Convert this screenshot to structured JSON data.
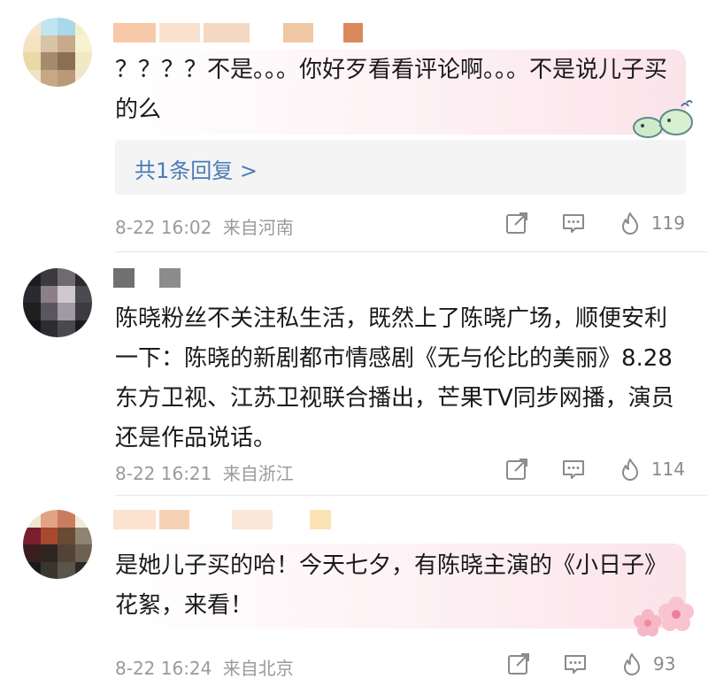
{
  "comments": [
    {
      "text": "？？？？不是。。。你好歹看看评论啊。。。不是说儿子买的么",
      "reply_link": "共1条回复 >",
      "timestamp": "8-22 16:02",
      "location": "来自河南",
      "likes": "119",
      "sticker_icon": "whale-sticker-icon"
    },
    {
      "text": "陈晓粉丝不关注私生活，既然上了陈晓广场，顺便安利一下：陈晓的新剧都市情感剧《无与伦比的美丽》8.28东方卫视、江苏卫视联合播出，芒果TV同步网播，演员还是作品说话。",
      "timestamp": "8-22 16:21",
      "location": "来自浙江",
      "likes": "114"
    },
    {
      "text": "是她儿子买的哈！今天七夕，有陈晓主演的《小日子》花絮，来看！",
      "timestamp": "8-22 16:24",
      "location": "来自北京",
      "likes": "93",
      "sticker_icon": "flower-sticker-icon"
    }
  ],
  "icons": {
    "share": "share-icon",
    "comment": "comment-icon",
    "like": "flame-like-icon"
  },
  "colors": {
    "link": "#4a7bb5",
    "meta": "#9a9a9a"
  }
}
